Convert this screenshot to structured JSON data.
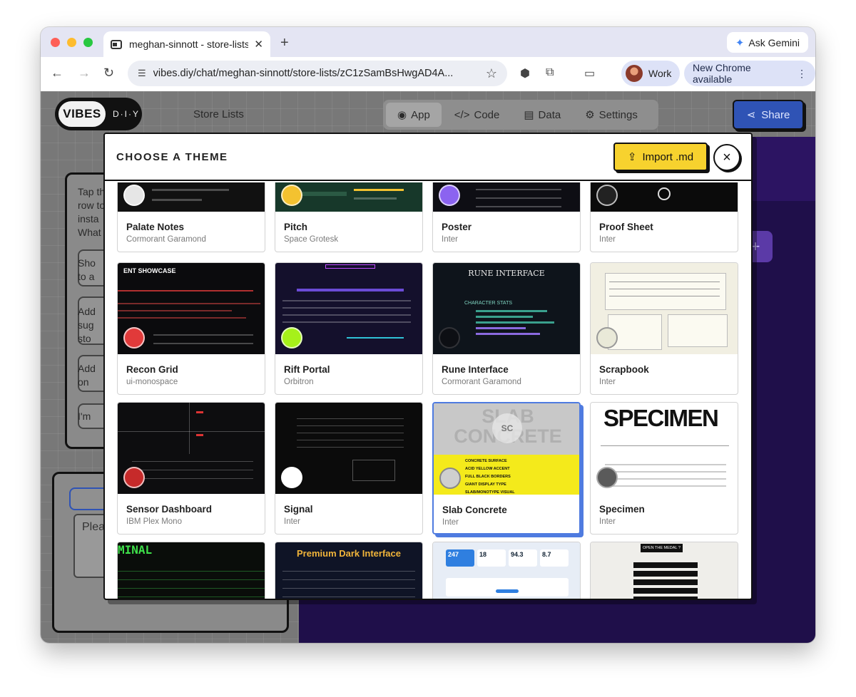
{
  "browser": {
    "tab_title": "meghan-sinnott - store-lists",
    "new_tab": "+",
    "ask_gemini": "Ask Gemini",
    "url": "vibes.diy/chat/meghan-sinnott/store-lists/zC1zSamBsHwgAD4A...",
    "profile": "Work",
    "update_notice": "New Chrome available"
  },
  "app": {
    "logo_main": "VIBES",
    "logo_sub": "D·I·Y",
    "project_name": "Store Lists",
    "tabs": [
      {
        "label": "App",
        "icon": "eye-icon",
        "active": true
      },
      {
        "label": "Code",
        "icon": "code-icon",
        "active": false
      },
      {
        "label": "Data",
        "icon": "data-icon",
        "active": false
      },
      {
        "label": "Settings",
        "icon": "gear-icon",
        "active": false
      }
    ],
    "share_label": "Share",
    "bg_text": [
      "Tap th",
      "row to",
      "insta",
      "What"
    ],
    "bg_rows": [
      [
        "Sho",
        "to a"
      ],
      [
        "Add",
        "sug",
        "sto"
      ],
      [
        "Add",
        "on"
      ],
      [
        "I'm"
      ]
    ],
    "bg_placeholder": "Plea",
    "add_button": "+"
  },
  "modal": {
    "title": "CHOOSE A THEME",
    "import_label": "Import .md",
    "close_label": "×"
  },
  "themes": [
    {
      "name": "Palate Notes",
      "font": "Cormorant Garamond",
      "dot": "#e6e6e6",
      "bg": "#111111"
    },
    {
      "name": "Pitch",
      "font": "Space Grotesk",
      "dot": "#f3c230",
      "bg": "#17382a"
    },
    {
      "name": "Poster",
      "font": "Inter",
      "dot": "#8b63f0",
      "bg": "#0e0e14"
    },
    {
      "name": "Proof Sheet",
      "font": "Inter",
      "dot": "#222222",
      "bg": "#0b0b0b"
    },
    {
      "name": "Recon Grid",
      "font": "ui-monospace",
      "dot": "#e13a3a",
      "bg": "#0b0b0d"
    },
    {
      "name": "Rift Portal",
      "font": "Orbitron",
      "dot": "#a6f11a",
      "bg": "#14102c"
    },
    {
      "name": "Rune Interface",
      "font": "Cormorant Garamond",
      "dot": "#0d0f14",
      "bg": "#0e141b"
    },
    {
      "name": "Scrapbook",
      "font": "Inter",
      "dot": "#e9e9d8",
      "bg": "#f1efe2"
    },
    {
      "name": "Sensor Dashboard",
      "font": "IBM Plex Mono",
      "dot": "#c62a2a",
      "bg": "#0d0d0f"
    },
    {
      "name": "Signal",
      "font": "Inter",
      "dot": "#ffffff",
      "bg": "#0b0b0b"
    },
    {
      "name": "Slab Concrete",
      "font": "Inter",
      "dot": "#cfcfcf",
      "bg": "#c8c8c8",
      "selected": true
    },
    {
      "name": "Specimen",
      "font": "Inter",
      "dot": "#5a5a5a",
      "bg": "#ffffff"
    },
    {
      "name": "",
      "font": "",
      "dot": "",
      "bg": "#0a0d0a"
    },
    {
      "name": "",
      "font": "",
      "dot": "",
      "bg": "#0f1426"
    },
    {
      "name": "",
      "font": "",
      "dot": "",
      "bg": "#e7edf6"
    },
    {
      "name": "",
      "font": "",
      "dot": "",
      "bg": "#efeeea"
    }
  ],
  "preview_text": {
    "recon": "ENT SHOWCASE",
    "rune": "RUNE INTERFACE",
    "rune_sub": "CHARACTER STATS",
    "slab": "SLAB CONCRETE",
    "slab_badge": "SC",
    "slab_rows": [
      "CONCRETE SURFACE",
      "ACID YELLOW ACCENT",
      "FULL BLACK BORDERS",
      "GIANT DISPLAY TYPE",
      "SLAB/MONOTYPE VISUAL"
    ],
    "specimen": "SPECIMEN",
    "terminal": "MINAL",
    "premium": "Premium Dark Interface",
    "stats": [
      "247",
      "18",
      "94.3",
      "8.7"
    ],
    "medal": "OPEN THE MEDAL ?"
  }
}
